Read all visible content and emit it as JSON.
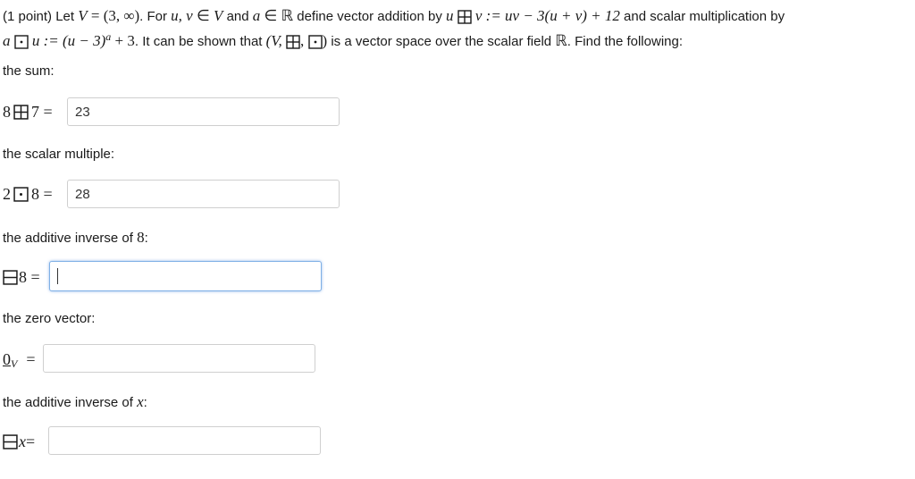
{
  "intro": {
    "p1": "(1 point) Let ",
    "V": "V",
    "eqset": " = (3, ∞)",
    "p2": ". For ",
    "uv": "u, v",
    "in1": " ∈ ",
    "V2": "V",
    "and": " and ",
    "a": "a",
    "in2": " ∈ ",
    "R": "ℝ",
    "p3": " define vector addition by ",
    "u1": "u",
    "v1": "v",
    "def_add": " := uv − 3(u + v) + 12",
    "p4": " and scalar multiplication by",
    "a2": "a",
    "u2": "u",
    "def_mul": " := (u − 3)",
    "sup_a": "a",
    "def_mul2": " + 3",
    "p5": ". It can be shown that ",
    "tuple_open": "(V, ",
    "tuple_mid": ", ",
    "tuple_close": ")",
    "p6": " is a vector space over the scalar field ",
    "R2": "ℝ",
    "p7": ". Find the following:"
  },
  "sum": {
    "label": "the sum:",
    "lhs_a": "8",
    "lhs_b": "7 =",
    "value": "23"
  },
  "scalar": {
    "label": "the scalar multiple:",
    "lhs_a": "2",
    "lhs_b": "8 =",
    "value": "28"
  },
  "inverse8": {
    "label": "the additive inverse of ",
    "label_num": "8",
    "label_end": ":",
    "lhs": "8 =",
    "value": ""
  },
  "zero": {
    "label": "the zero vector:",
    "lhs": "0",
    "sub": "V",
    "eq": "=",
    "value": ""
  },
  "inversex": {
    "label": "the additive inverse of ",
    "label_var": "x",
    "label_end": ":",
    "lhs": "x",
    "eq": " =",
    "value": ""
  }
}
